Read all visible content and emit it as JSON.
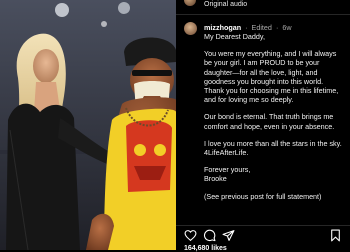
{
  "post": {
    "audio_label": "Original audio",
    "caption": {
      "username": "mizzhogan",
      "edited": "Edited",
      "age": "6w",
      "paragraphs": [
        "My Dearest Daddy,",
        "You were my everything, and I will always be your girl. I am PROUD to be your daughter—for all the love, light, and goodness you brought into this world. Thank you for choosing me in this lifetime, and for loving me so deeply.",
        "Our bond is eternal. That truth brings me comfort and hope, even in your absence.",
        "I love you more than all the stars in the sky. 4LifeAfterLife.",
        "Forever yours,",
        "Brooke",
        "(See previous post for full statement)"
      ]
    },
    "actions": {
      "like_icon": "heart-icon",
      "comment_icon": "comment-icon",
      "share_icon": "send-icon",
      "save_icon": "bookmark-icon"
    },
    "likes": "164,680 likes"
  },
  "colors": {
    "background": "#000000",
    "text": "#ffffff",
    "muted": "#a8a8a8"
  }
}
